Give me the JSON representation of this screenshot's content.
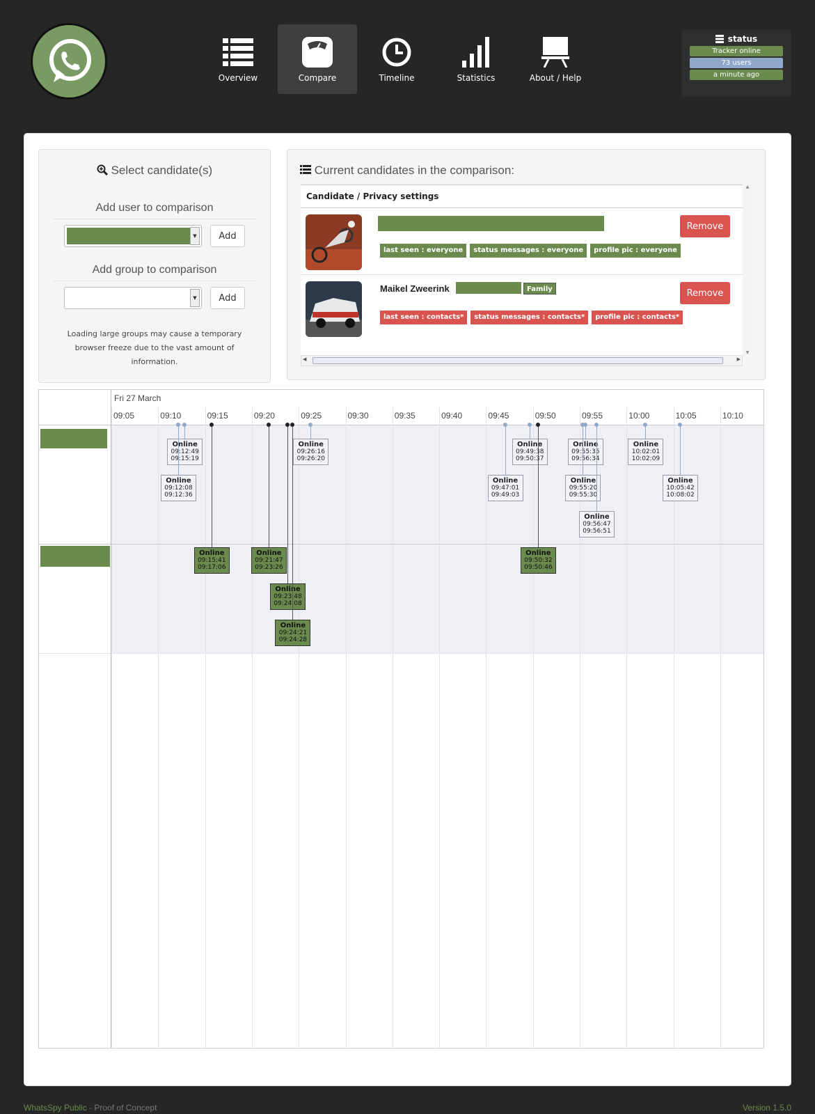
{
  "nav": {
    "items": [
      {
        "label": "Overview",
        "icon": "list-icon"
      },
      {
        "label": "Compare",
        "icon": "scale-icon",
        "active": true
      },
      {
        "label": "Timeline",
        "icon": "clock-icon"
      },
      {
        "label": "Statistics",
        "icon": "bar-chart-icon"
      },
      {
        "label": "About / Help",
        "icon": "presentation-icon"
      }
    ]
  },
  "status": {
    "title": "status",
    "tracker": "Tracker online",
    "users": "73 users",
    "updated": "a minute ago",
    "colors": {
      "tracker": "#6b8b4e",
      "users": "#8fa8cc",
      "updated": "#6b8b4e"
    }
  },
  "select": {
    "title": "Select candidate(s)",
    "add_user_label": "Add user to comparison",
    "add_group_label": "Add group to comparison",
    "add_button": "Add",
    "note": "Loading large groups may cause a temporary browser freeze due to the vast amount of information."
  },
  "candidates": {
    "title": "Current candidates in the comparison:",
    "header": "Candidate / Privacy settings",
    "remove_label": "Remove",
    "rows": [
      {
        "name": "",
        "tags": [
          {
            "text": "last seen : everyone",
            "color": "green"
          },
          {
            "text": "status messages : everyone",
            "color": "green"
          },
          {
            "text": "profile pic : everyone",
            "color": "green"
          }
        ]
      },
      {
        "name": "Maikel Zweerink",
        "group": "Family",
        "tags": [
          {
            "text": "last seen : contacts*",
            "color": "red"
          },
          {
            "text": "status messages : contacts*",
            "color": "red"
          },
          {
            "text": "profile pic : contacts*",
            "color": "red"
          }
        ]
      }
    ]
  },
  "timeline": {
    "date": "Fri 27 March",
    "ticks": [
      "09:05",
      "09:10",
      "09:15",
      "09:20",
      "09:25",
      "09:30",
      "09:35",
      "09:40",
      "09:45",
      "09:50",
      "09:55",
      "10:00",
      "10:05",
      "10:10"
    ],
    "status_word": "Online",
    "user1_sessions": [
      {
        "start": "09:12:49",
        "end": "09:15:19"
      },
      {
        "start": "09:12:08",
        "end": "09:12:36"
      },
      {
        "start": "09:26:16",
        "end": "09:26:20"
      },
      {
        "start": "09:49:38",
        "end": "09:50:37"
      },
      {
        "start": "09:47:01",
        "end": "09:49:03"
      },
      {
        "start": "09:55:35",
        "end": "09:56:34"
      },
      {
        "start": "09:55:20",
        "end": "09:55:30"
      },
      {
        "start": "09:56:47",
        "end": "09:56:51"
      },
      {
        "start": "10:02:01",
        "end": "10:02:09"
      },
      {
        "start": "10:05:42",
        "end": "10:08:02"
      }
    ],
    "user2_sessions": [
      {
        "start": "09:15:41",
        "end": "09:17:06"
      },
      {
        "start": "09:21:47",
        "end": "09:23:26"
      },
      {
        "start": "09:23:48",
        "end": "09:24:08"
      },
      {
        "start": "09:24:21",
        "end": "09:24:28"
      },
      {
        "start": "09:50:32",
        "end": "09:50:46"
      }
    ]
  },
  "footer": {
    "app": "WhatsSpy Public",
    "sep": " - ",
    "subtitle": "Proof of Concept",
    "version": "Version 1.5.0"
  }
}
